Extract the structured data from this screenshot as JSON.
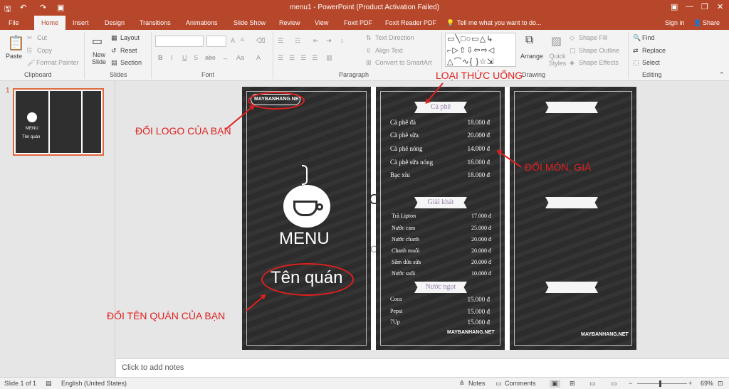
{
  "window": {
    "title": "menu1 - PowerPoint (Product Activation Failed)",
    "buttons": {
      "ribbon_opts": "▣",
      "min": "—",
      "max": "❐",
      "close": "✕"
    }
  },
  "tabs": [
    "File",
    "Home",
    "Insert",
    "Design",
    "Transitions",
    "Animations",
    "Slide Show",
    "Review",
    "View",
    "Foxit PDF",
    "Foxit Reader PDF"
  ],
  "tell_me": "Tell me what you want to do...",
  "account": {
    "signin": "Sign in",
    "share": "Share"
  },
  "ribbon": {
    "clipboard": {
      "paste": "Paste",
      "cut": "Cut",
      "copy": "Copy",
      "format_painter": "Format Painter",
      "label": "Clipboard"
    },
    "slides": {
      "new_slide": "New Slide",
      "layout": "Layout",
      "reset": "Reset",
      "section": "Section",
      "label": "Slides"
    },
    "font": {
      "label": "Font",
      "bold": "B",
      "italic": "I",
      "underline": "U",
      "strike": "S",
      "abc": "abc",
      "grow": "A",
      "shrink": "A"
    },
    "paragraph": {
      "text_direction": "Text Direction",
      "align_text": "Align Text",
      "smartart": "Convert to SmartArt",
      "label": "Paragraph"
    },
    "drawing": {
      "arrange": "Arrange",
      "quick_styles": "Quick Styles",
      "shape_fill": "Shape Fill",
      "shape_outline": "Shape Outline",
      "shape_effects": "Shape Effects",
      "label": "Drawing"
    },
    "editing": {
      "find": "Find",
      "replace": "Replace",
      "select": "Select",
      "label": "Editing"
    }
  },
  "thumbnail": {
    "number": "1",
    "menu": "MENU",
    "name": "Tên quán"
  },
  "slide": {
    "logo": "MAYBANHANG.NET",
    "menu_title": "MENU",
    "shop_name": "Tên quán",
    "section1": "Cà phê",
    "section2": "Giải khát",
    "section3": "Nước ngọt",
    "items1": [
      {
        "name": "Cà phê đá",
        "price": "18.000 đ"
      },
      {
        "name": "Cà phê sữa",
        "price": "20.000 đ"
      },
      {
        "name": "Cà phê nóng",
        "price": "14.000 đ"
      },
      {
        "name": "Cà phê sữa nóng",
        "price": "16.000 đ"
      },
      {
        "name": "Bạc xỉu",
        "price": "18.000 đ"
      }
    ],
    "items2": [
      {
        "name": "Trà Lipton",
        "price": "17.000 đ"
      },
      {
        "name": "Nước cam",
        "price": "25.000 đ"
      },
      {
        "name": "Nước chanh",
        "price": "20.000 đ"
      },
      {
        "name": "Chanh muối",
        "price": "20.000 đ"
      },
      {
        "name": "Sâm dứa sữa",
        "price": "20.000 đ"
      },
      {
        "name": "Nước suối",
        "price": "10.000 đ"
      }
    ],
    "items3": [
      {
        "name": "Coca",
        "price": "15.000 đ"
      },
      {
        "name": "Pepsi",
        "price": "15.000 đ"
      },
      {
        "name": "7Up",
        "price": "15.000 đ"
      }
    ]
  },
  "annotations": {
    "logo": "ĐỔI LOGO CỦA BẠN",
    "drink_type": "LOẠI THỨC UỐNG",
    "items": "ĐỔI MÓN, GIÁ",
    "shop": "ĐỔI TÊN QUÁN CỦA BẠN"
  },
  "notes_placeholder": "Click to add notes",
  "status": {
    "slide": "Slide 1 of 1",
    "language": "English (United States)",
    "notes": "Notes",
    "comments": "Comments",
    "zoom": "69%"
  },
  "colors": {
    "accent": "#b7472a",
    "annotation": "#e01f1f",
    "chalkboard": "#2e2e2e"
  }
}
